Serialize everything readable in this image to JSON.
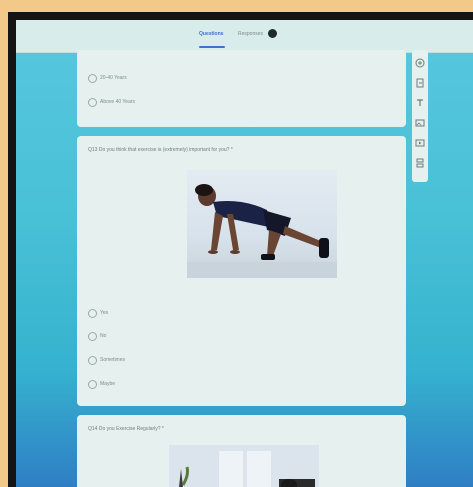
{
  "tabs": [
    {
      "label": "Questions",
      "active": true
    },
    {
      "label": "Responses",
      "active": false
    }
  ],
  "responses_badge": "",
  "card1": {
    "options": [
      "20-40 Years",
      "Above 40 Years"
    ]
  },
  "card2": {
    "question": "Q13 Do you think that exercise is (extremely) important for you? *",
    "options": [
      "Yes",
      "No",
      "Sometimes",
      "Maybe"
    ]
  },
  "card3": {
    "question": "Q14 Do you Exercise Regularly? *"
  },
  "toolbar_icons": [
    "add-question-icon",
    "import-questions-icon",
    "add-title-icon",
    "add-image-icon",
    "add-video-icon",
    "add-section-icon"
  ],
  "colors": {
    "accent": "#3f6fd1",
    "background_top": "#58c7de",
    "card": "#e6f1ef"
  }
}
